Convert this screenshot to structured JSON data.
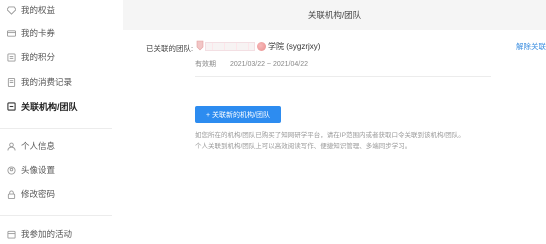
{
  "sidebar": {
    "items": [
      {
        "label": "我的权益",
        "icon": "diamond-icon",
        "active": false
      },
      {
        "label": "我的卡券",
        "icon": "card-icon",
        "active": false
      },
      {
        "label": "我的积分",
        "icon": "points-icon",
        "active": false
      },
      {
        "label": "我的消费记录",
        "icon": "receipt-icon",
        "active": false
      },
      {
        "label": "关联机构/团队",
        "icon": "link-icon",
        "active": true
      },
      {
        "label": "个人信息",
        "icon": "user-icon",
        "active": false
      },
      {
        "label": "头像设置",
        "icon": "avatar-icon",
        "active": false
      },
      {
        "label": "修改密码",
        "icon": "lock-icon",
        "active": false
      },
      {
        "label": "我参加的活动",
        "icon": "activity-icon",
        "active": false
      }
    ]
  },
  "main": {
    "title": "关联机构/团队",
    "linked_team_label": "已关联的团队:",
    "team_name": "学院 (sygzrjxy)",
    "unlink_label": "解除关联",
    "validity_label": "有效期",
    "validity_value": "2021/03/22 ~ 2021/04/22",
    "add_button_label": "+ 关联新的机构/团队",
    "description_line1": "如您所在的机构/团队已购买了知网研学平台，请在IP范围内或者获取口令关联到该机构/团队。",
    "description_line2": "个人关联到机构/团队上可以高效阅读写作、便捷知识管理、多端同步学习。"
  },
  "colors": {
    "accent": "#2d8cf0",
    "link": "#3a8de0",
    "main_bg": "#f5f5f5"
  }
}
